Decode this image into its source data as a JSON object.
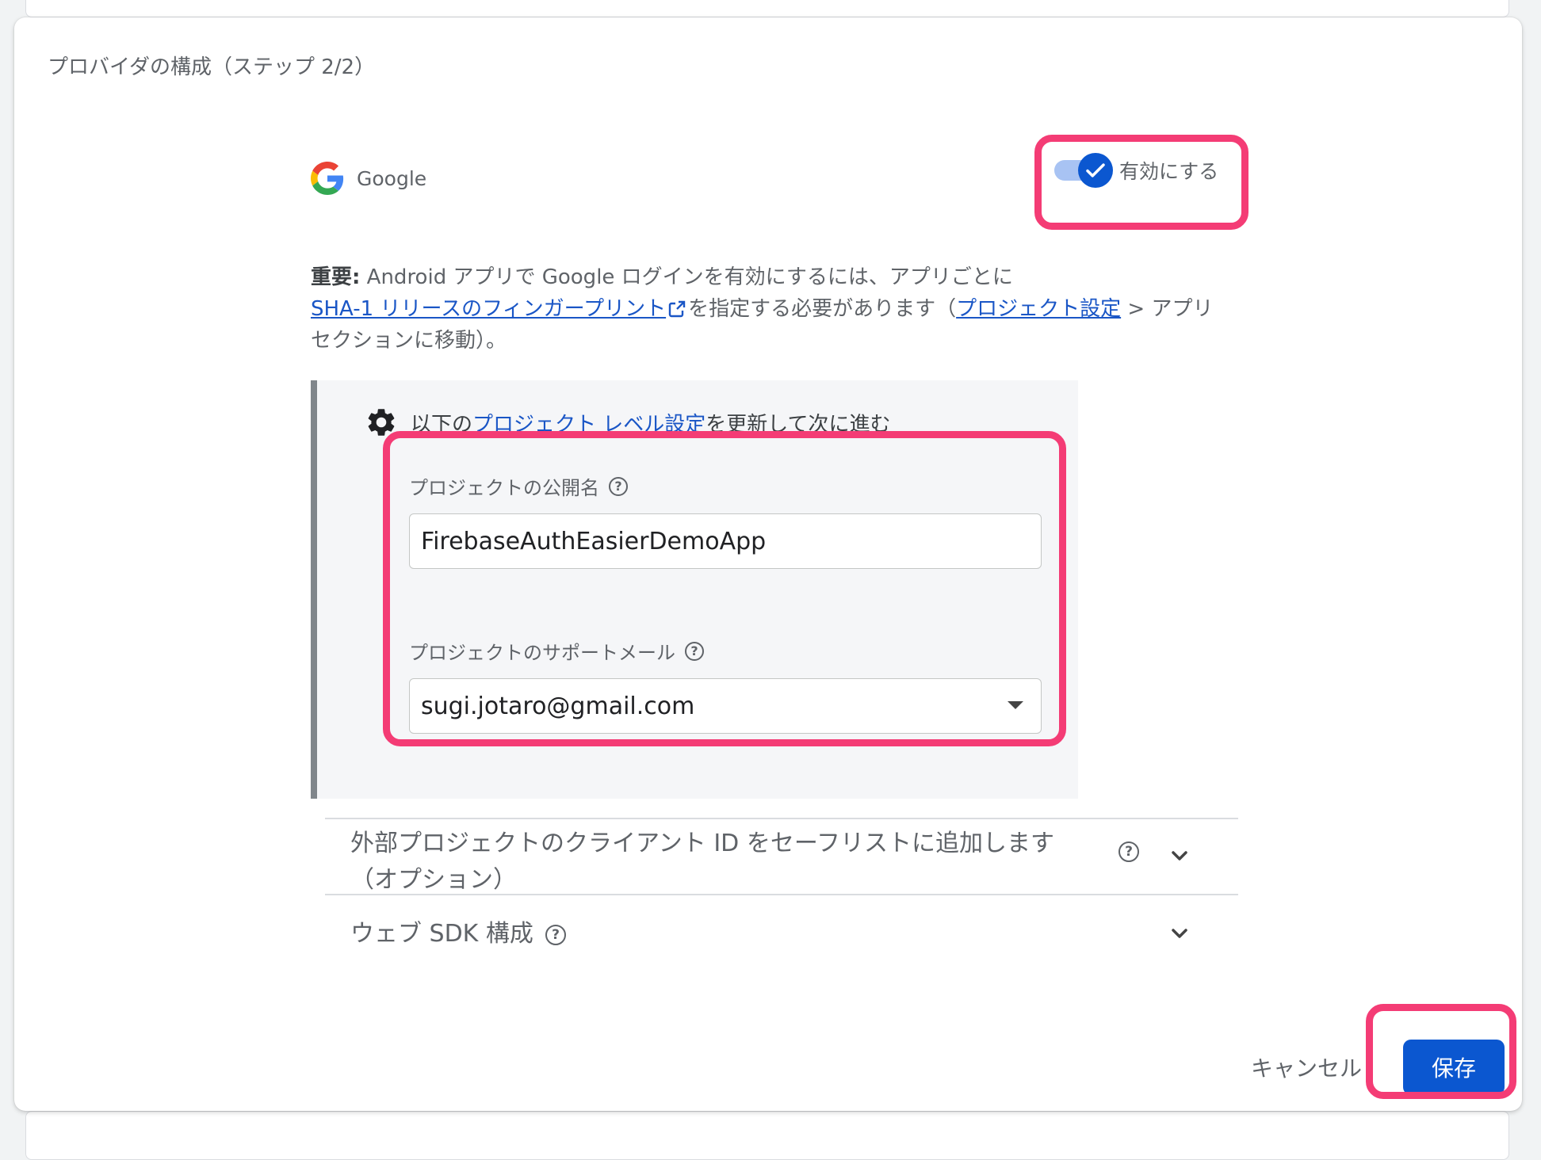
{
  "dialog": {
    "title": "プロバイダの構成（ステップ 2/2）"
  },
  "provider": {
    "name": "Google",
    "logo_icon": "google-g-icon"
  },
  "toggle": {
    "label": "有効にする",
    "enabled": true
  },
  "notice": {
    "bold": "重要:",
    "text1": " Android アプリで Google ログインを有効にするには、アプリごとに",
    "link1": "SHA-1 リリースのフィンガープリント",
    "text2": "を指定する必要があります（",
    "link2": "プロジェクト設定",
    "text3": " > アプリ セクションに移動）。"
  },
  "panel": {
    "head_prefix": "以下の",
    "head_link": "プロジェクト レベル設定",
    "head_suffix": "を更新して次に進む",
    "public_name_label": "プロジェクトの公開名",
    "public_name_value": "FirebaseAuthEasierDemoApp",
    "support_email_label": "プロジェクトのサポートメール",
    "support_email_value": "sugi.jotaro@gmail.com"
  },
  "accordions": [
    {
      "title_line1": "外部プロジェクトのクライアント ID をセーフリストに追加します",
      "title_line2": "（オプション）"
    },
    {
      "title_line1": "ウェブ SDK 構成"
    }
  ],
  "footer": {
    "cancel_label": "キャンセル",
    "save_label": "保存"
  },
  "colors": {
    "accent": "#0b57d0",
    "highlight": "#f43c75",
    "link": "#1a56c6"
  }
}
